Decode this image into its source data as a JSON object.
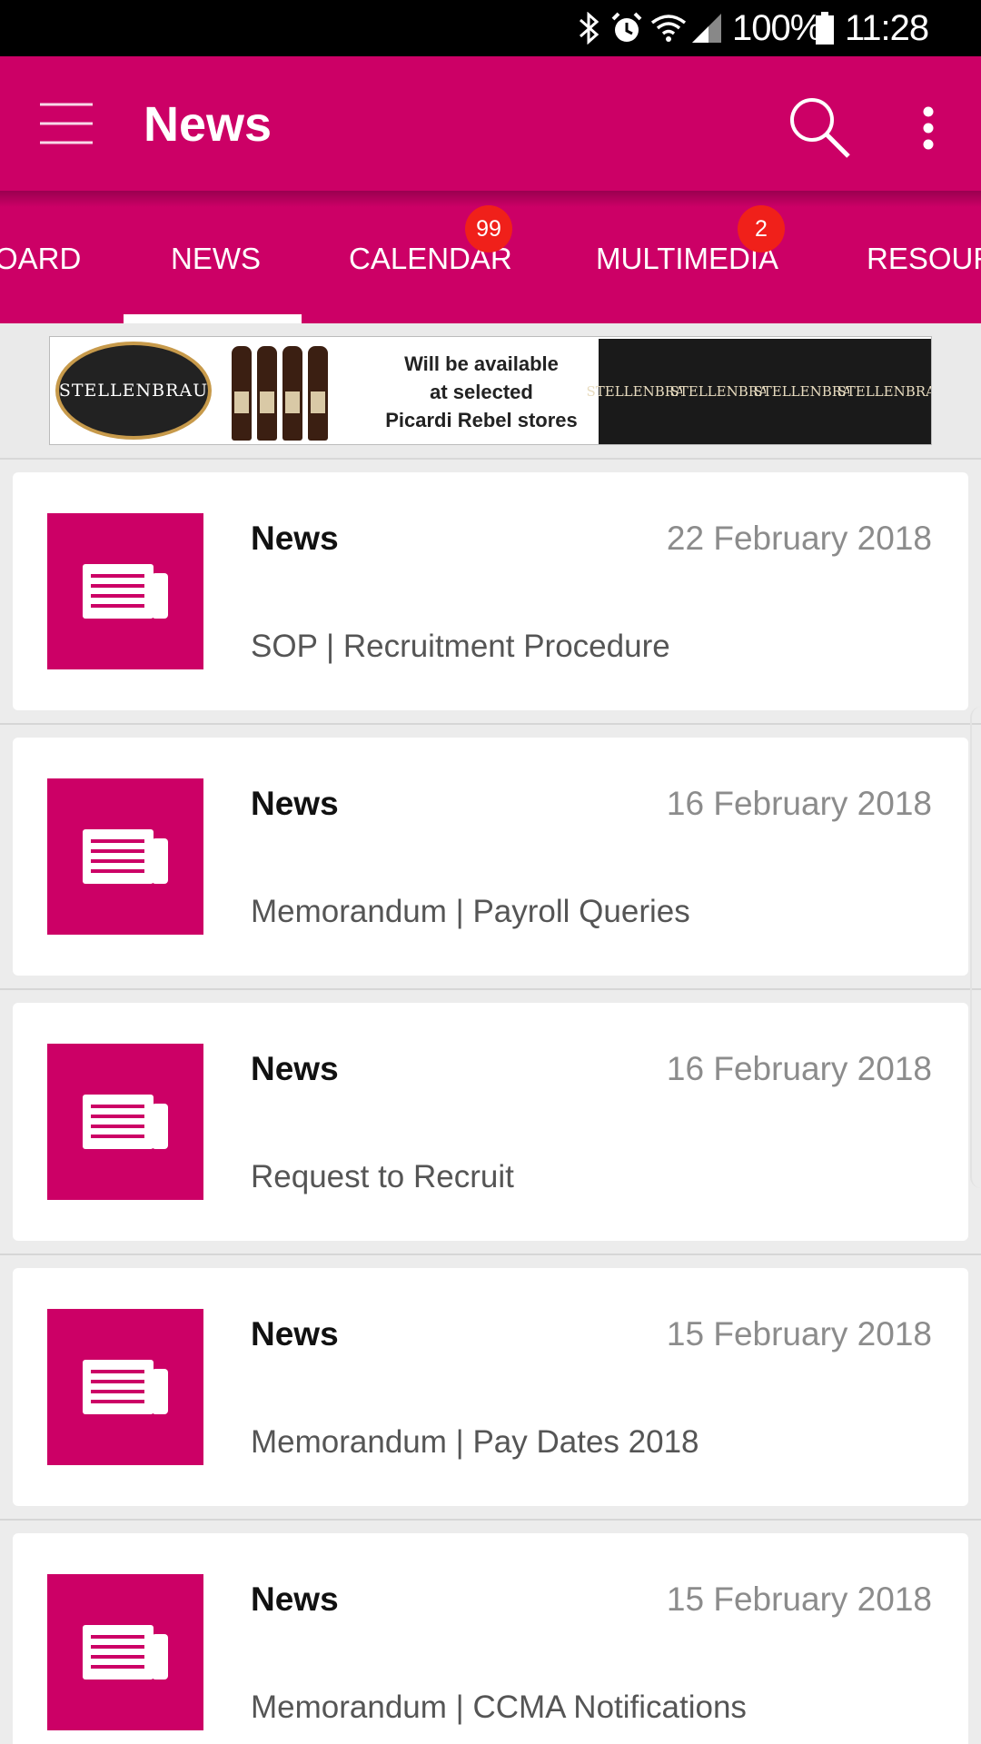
{
  "status_bar": {
    "battery": "100%",
    "time": "11:28",
    "icons": [
      "bluetooth-icon",
      "alarm-icon",
      "wifi-icon",
      "signal-icon",
      "battery-icon"
    ]
  },
  "app_bar": {
    "title": "News",
    "icons": [
      "menu-icon",
      "search-icon",
      "more-vert-icon"
    ]
  },
  "tabs": [
    {
      "label": "OARD"
    },
    {
      "label": "NEWS",
      "selected": true
    },
    {
      "label": "CALENDAR",
      "badge": "99"
    },
    {
      "label": "MULTIMEDIA",
      "badge": "2"
    },
    {
      "label": "RESOUR"
    }
  ],
  "banner": {
    "brand": "STELLENBRAU",
    "text_line1": "Will be available",
    "text_line2": "at selected",
    "text_line3": "Picardi Rebel stores",
    "labels": [
      "STELLENBRAU",
      "STELLENBRAU",
      "STELLENBRAU",
      "STELLENBRAU"
    ]
  },
  "news": [
    {
      "category": "News",
      "date": "22 February 2018",
      "title": "SOP | Recruitment Procedure"
    },
    {
      "category": "News",
      "date": "16 February 2018",
      "title": "Memorandum | Payroll Queries"
    },
    {
      "category": "News",
      "date": "16 February 2018",
      "title": "Request to Recruit"
    },
    {
      "category": "News",
      "date": "15 February 2018",
      "title": "Memorandum | Pay Dates 2018"
    },
    {
      "category": "News",
      "date": "15 February 2018",
      "title": "Memorandum | CCMA Notifications"
    }
  ],
  "colors": {
    "brand": "#cc0066",
    "badge": "#f0201a",
    "status_bar": "#000000"
  }
}
